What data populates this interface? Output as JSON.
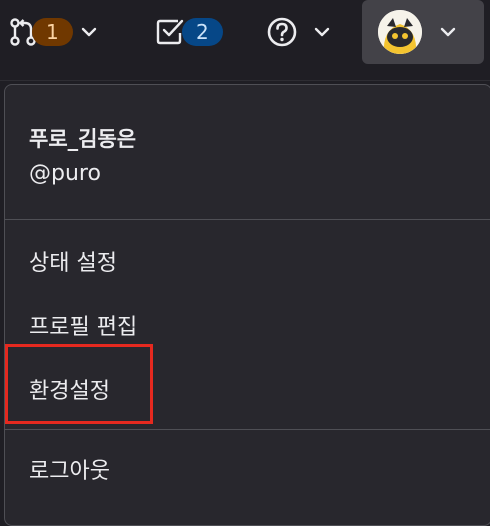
{
  "topbar": {
    "merge_requests": {
      "icon": "merge-request-icon",
      "count": "1"
    },
    "todos": {
      "icon": "todo-checkbox-icon",
      "count": "2"
    },
    "help": {
      "icon": "help-icon"
    },
    "user": {
      "icon": "avatar"
    }
  },
  "dropdown": {
    "user_name": "푸로_김동은",
    "user_handle": "@puro",
    "items": [
      {
        "label": "상태 설정"
      },
      {
        "label": "프로필 편집"
      },
      {
        "label": "환경설정"
      },
      {
        "label": "로그아웃"
      }
    ]
  },
  "colors": {
    "background": "#1f1e24",
    "dropdown_bg": "#28272d",
    "highlight": "#e5291f",
    "badge_mr_bg": "#703800",
    "badge_todo_bg": "#064787"
  }
}
